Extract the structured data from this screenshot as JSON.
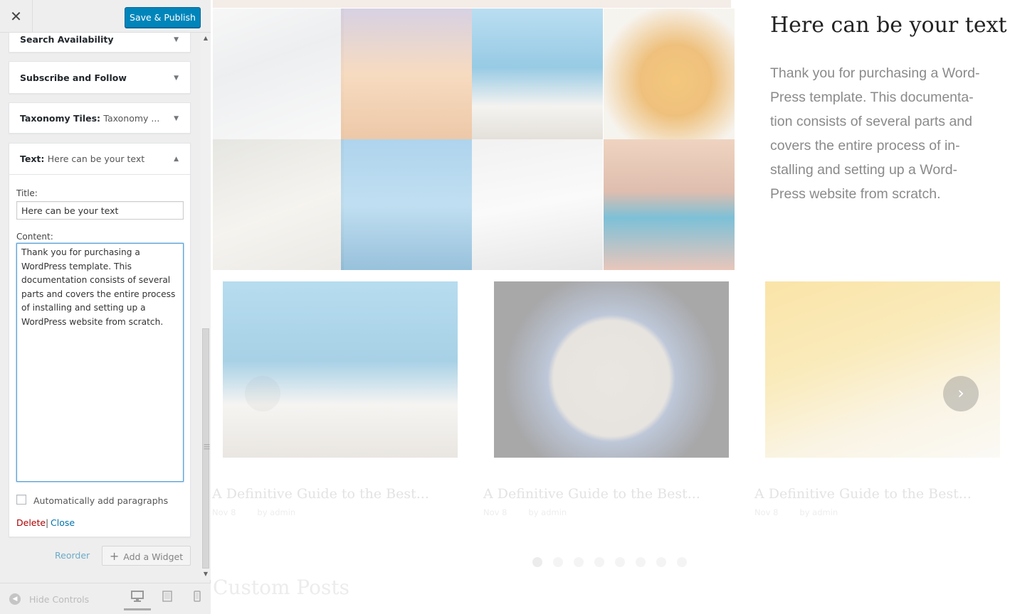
{
  "topbar": {
    "close_glyph": "✕",
    "save_label": "Save & Publish"
  },
  "widgets": {
    "search": {
      "title": "Search Availability"
    },
    "subscribe": {
      "title": "Subscribe and Follow"
    },
    "taxonomy": {
      "title": "Taxonomy Tiles:",
      "subtitle": "Taxonomy ..."
    },
    "text": {
      "title": "Text:",
      "subtitle": "Here can be your text",
      "title_label": "Title:",
      "title_value": "Here can be your text",
      "content_label": "Content:",
      "content_value": "Thank you for purchasing a WordPress template. This documentation consists of several parts and covers the entire process of installing and setting up a WordPress website from scratch.",
      "auto_paragraphs_label": "Automatically add paragraphs",
      "auto_paragraphs_checked": false,
      "delete_label": "Delete",
      "separator": "|",
      "close_label": "Close"
    }
  },
  "actions": {
    "reorder_label": "Reorder",
    "add_widget_label": "Add a Widget"
  },
  "footer": {
    "hide_controls_label": "Hide Controls",
    "devices": [
      "desktop-icon",
      "tablet-icon",
      "mobile-icon"
    ],
    "active_device": "desktop"
  },
  "preview": {
    "text_widget": {
      "title": "Here can be your text",
      "body": "Thank you for purchasing a Word-Press template. This documenta-tion consists of several parts and covers the entire process of in-stalling and setting up a Word-Press website from scratch."
    },
    "posts": [
      {
        "title": "A Definitive Guide to the Best...",
        "date": "Nov 8",
        "author": "by admin"
      },
      {
        "title": "A Definitive Guide to the Best...",
        "date": "Nov 8",
        "author": "by admin"
      },
      {
        "title": "A Definitive Guide to the Best...",
        "date": "Nov 8",
        "author": "by admin"
      }
    ],
    "carousel_dots": 8,
    "active_dot": 1,
    "section_title": "Custom Posts"
  },
  "colors": {
    "accent": "#0085ba",
    "link": "#0073aa",
    "delete": "#aa0000"
  }
}
